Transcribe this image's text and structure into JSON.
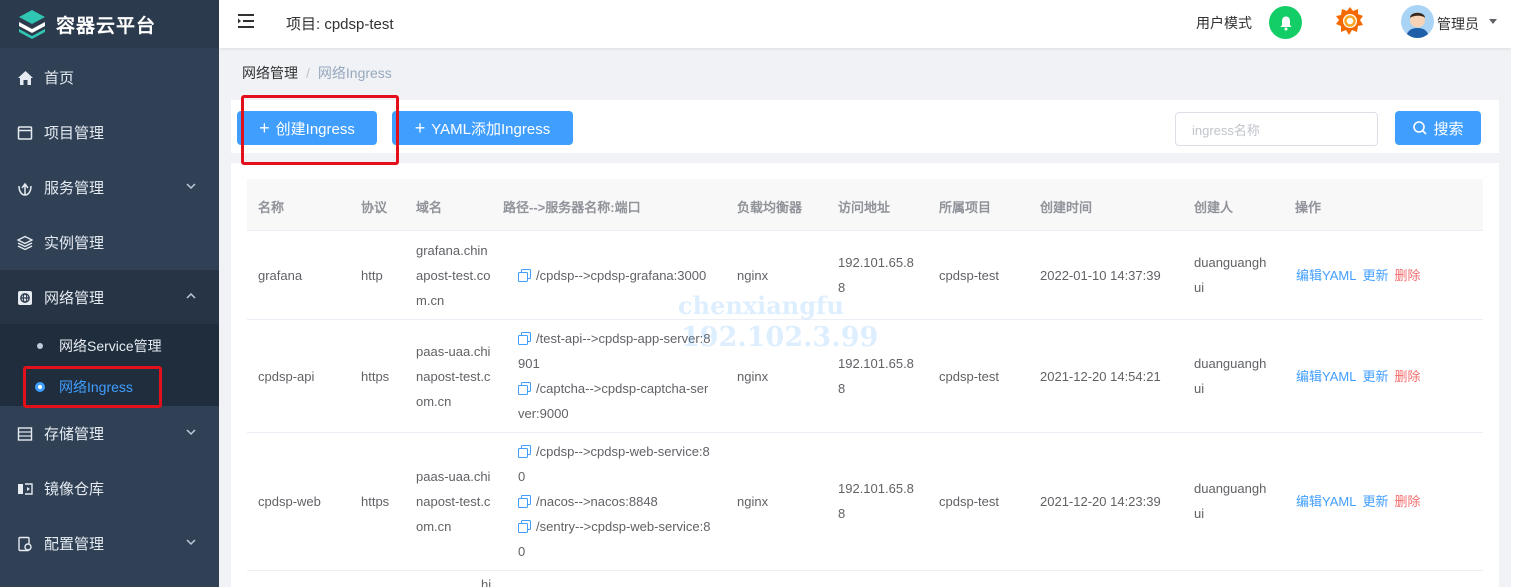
{
  "app": {
    "title": "容器云平台"
  },
  "sidebar": {
    "items": [
      {
        "label": "首页",
        "icon": "home-icon"
      },
      {
        "label": "项目管理",
        "icon": "project-icon"
      },
      {
        "label": "服务管理",
        "icon": "service-icon"
      },
      {
        "label": "实例管理",
        "icon": "layers-icon"
      },
      {
        "label": "网络管理",
        "icon": "network-icon"
      },
      {
        "label": "存储管理",
        "icon": "storage-icon"
      },
      {
        "label": "镜像仓库",
        "icon": "image-repo-icon"
      },
      {
        "label": "配置管理",
        "icon": "config-icon"
      }
    ],
    "network_sub": [
      {
        "label": "网络Service管理"
      },
      {
        "label": "网络Ingress"
      }
    ]
  },
  "header": {
    "project": "项目: cpdsp-test",
    "user_mode": "用户模式",
    "user_name": "管理员"
  },
  "breadcrumb": {
    "parent": "网络管理",
    "current": "网络Ingress"
  },
  "toolbar": {
    "create_label": "创建Ingress",
    "yaml_label": "YAML添加Ingress",
    "search_placeholder": "ingress名称",
    "search_label": "搜索"
  },
  "table": {
    "headers": [
      "名称",
      "协议",
      "域名",
      "路径-->服务器名称:端口",
      "负载均衡器",
      "访问地址",
      "所属项目",
      "创建时间",
      "创建人",
      "操作"
    ],
    "rows": [
      {
        "name": "grafana",
        "protocol": "http",
        "domain": [
          "grafana.chin",
          "apost-test.co",
          "m.cn"
        ],
        "paths": [
          [
            "/cpdsp-->cpdsp-grafana:3000"
          ]
        ],
        "lb": "nginx",
        "address": [
          "192.101.65.8",
          "8"
        ],
        "project": "cpdsp-test",
        "created": "2022-01-10 14:37:39",
        "creator": [
          "duanguangh",
          "ui"
        ],
        "op_edit": "编辑YAML",
        "op_update": "更新",
        "op_delete": "删除"
      },
      {
        "name": "cpdsp-api",
        "protocol": "https",
        "domain": [
          "paas-uaa.chi",
          "napost-test.c",
          "om.cn"
        ],
        "paths": [
          [
            "/test-api-->cpdsp-app-server:8",
            "901"
          ],
          [
            "/captcha-->cpdsp-captcha-ser",
            "ver:9000"
          ]
        ],
        "lb": "nginx",
        "address": [
          "192.101.65.8",
          "8"
        ],
        "project": "cpdsp-test",
        "created": "2021-12-20 14:54:21",
        "creator": [
          "duanguangh",
          "ui"
        ],
        "op_edit": "编辑YAML",
        "op_update": "更新",
        "op_delete": "删除"
      },
      {
        "name": "cpdsp-web",
        "protocol": "https",
        "domain": [
          "paas-uaa.chi",
          "napost-test.c",
          "om.cn"
        ],
        "paths": [
          [
            "/cpdsp-->cpdsp-web-service:8",
            "0"
          ],
          [
            "/nacos-->nacos:8848"
          ],
          [
            "/sentry-->cpdsp-web-service:8",
            "0"
          ]
        ],
        "lb": "nginx",
        "address": [
          "192.101.65.8",
          "8"
        ],
        "project": "cpdsp-test",
        "created": "2021-12-20 14:23:39",
        "creator": [
          "duanguangh",
          "ui"
        ],
        "op_edit": "编辑YAML",
        "op_update": "更新",
        "op_delete": "删除"
      }
    ],
    "partial_row_text": "hi"
  },
  "watermark": {
    "line1": "chenxiangfu",
    "line2": "192.102.3.99"
  },
  "colors": {
    "sidebar": "#304156",
    "accent": "#409eff",
    "danger": "#f56c6c",
    "bell": "#13ce66",
    "highlight": "#e3101b"
  }
}
